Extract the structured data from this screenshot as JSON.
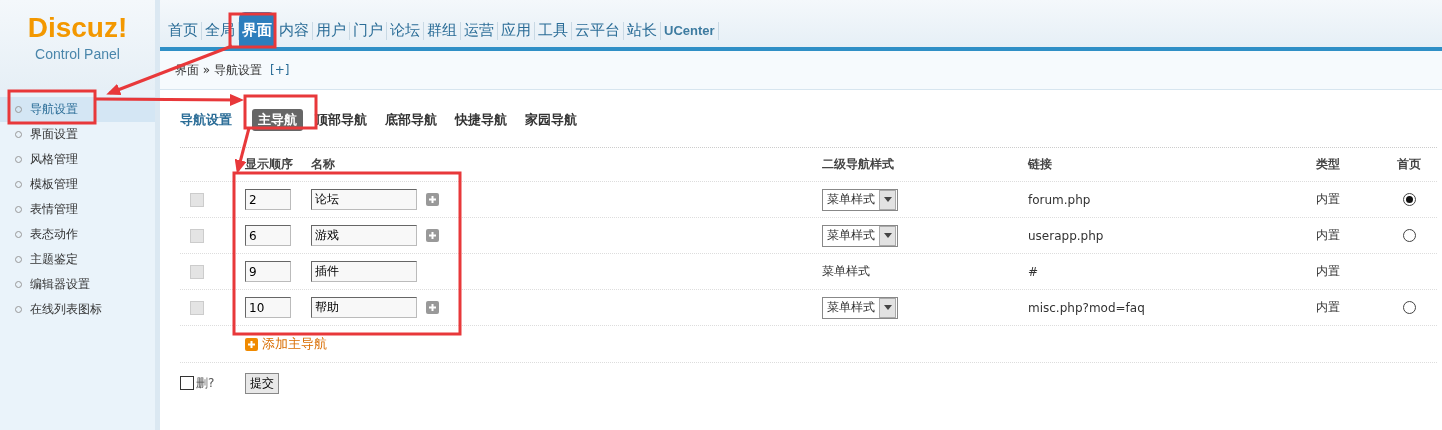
{
  "logo": {
    "name": "Discuz!",
    "subtitle": "Control Panel"
  },
  "top_nav": [
    {
      "label": "首页",
      "selected": false
    },
    {
      "label": "全局",
      "selected": false
    },
    {
      "label": "界面",
      "selected": true
    },
    {
      "label": "内容",
      "selected": false
    },
    {
      "label": "用户",
      "selected": false
    },
    {
      "label": "门户",
      "selected": false
    },
    {
      "label": "论坛",
      "selected": false
    },
    {
      "label": "群组",
      "selected": false
    },
    {
      "label": "运营",
      "selected": false
    },
    {
      "label": "应用",
      "selected": false
    },
    {
      "label": "工具",
      "selected": false
    },
    {
      "label": "云平台",
      "selected": false
    },
    {
      "label": "站长",
      "selected": false
    },
    {
      "label": "UCenter",
      "selected": false
    }
  ],
  "breadcrumb": {
    "items": [
      "界面",
      "导航设置"
    ],
    "separator": "»",
    "add": "[+]"
  },
  "sidebar": {
    "items": [
      {
        "label": "导航设置",
        "selected": true
      },
      {
        "label": "界面设置",
        "selected": false
      },
      {
        "label": "风格管理",
        "selected": false
      },
      {
        "label": "模板管理",
        "selected": false
      },
      {
        "label": "表情管理",
        "selected": false
      },
      {
        "label": "表态动作",
        "selected": false
      },
      {
        "label": "主题鉴定",
        "selected": false
      },
      {
        "label": "编辑器设置",
        "selected": false
      },
      {
        "label": "在线列表图标",
        "selected": false
      }
    ]
  },
  "section": {
    "title": "导航设置",
    "tabs": [
      {
        "label": "主导航",
        "selected": true
      },
      {
        "label": "顶部导航",
        "selected": false
      },
      {
        "label": "底部导航",
        "selected": false
      },
      {
        "label": "快捷导航",
        "selected": false
      },
      {
        "label": "家园导航",
        "selected": false
      }
    ]
  },
  "table": {
    "columns": [
      "显示顺序",
      "名称",
      "二级导航样式",
      "链接",
      "类型",
      "首页"
    ],
    "rows": [
      {
        "disabled": true,
        "order": "2",
        "name": "论坛",
        "expandable": true,
        "style": {
          "kind": "select",
          "value": "菜单样式"
        },
        "link": "forum.php",
        "type": "内置",
        "home": {
          "selected": true
        }
      },
      {
        "disabled": true,
        "order": "6",
        "name": "游戏",
        "expandable": true,
        "style": {
          "kind": "select",
          "value": "菜单样式"
        },
        "link": "userapp.php",
        "type": "内置",
        "home": {
          "selected": false
        }
      },
      {
        "disabled": true,
        "order": "9",
        "name": "插件",
        "expandable": false,
        "style": {
          "kind": "text",
          "value": "菜单样式"
        },
        "link": "#",
        "type": "内置"
      },
      {
        "disabled": true,
        "order": "10",
        "name": "帮助",
        "expandable": true,
        "style": {
          "kind": "select",
          "value": "菜单样式"
        },
        "link": "misc.php?mod=faq",
        "type": "内置",
        "home": {
          "selected": false
        }
      }
    ],
    "add_link": "添加主导航"
  },
  "footer": {
    "delete_label": "删?",
    "delete_checked": false,
    "submit": "提交"
  }
}
